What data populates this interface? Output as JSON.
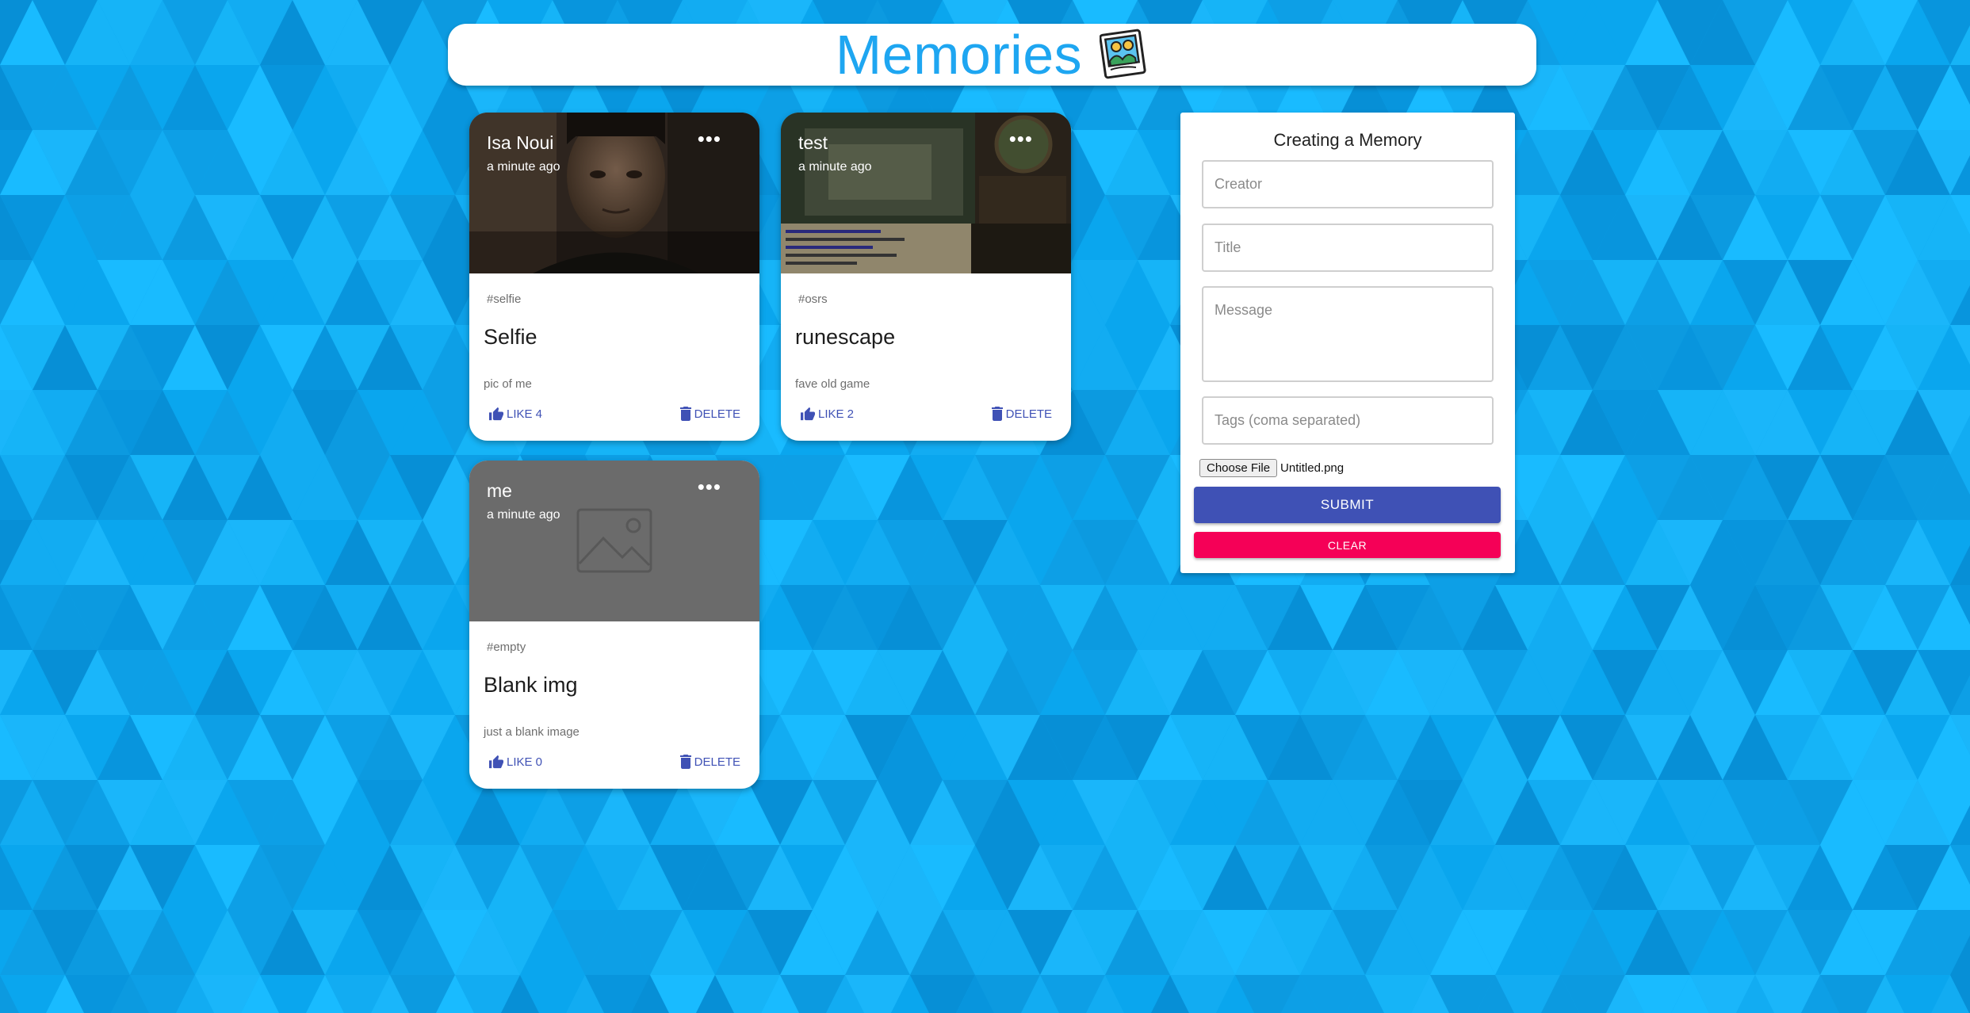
{
  "colors": {
    "primary": "#3f51b5",
    "secondary": "#f50057",
    "title_blue": "#1ea6f1",
    "background": "#0aa6ee"
  },
  "header": {
    "title": "Memories",
    "logo_icon": "memories-photo-icon"
  },
  "posts": [
    {
      "creator": "Isa Noui",
      "time": "a minute ago",
      "tags": "#selfie",
      "title": "Selfie",
      "message": "pic of me",
      "like_label": "LIKE 4",
      "delete_label": "DELETE",
      "more_label": "•••",
      "image": "selfie-photo"
    },
    {
      "creator": "test",
      "time": "a minute ago",
      "tags": "#osrs",
      "title": "runescape",
      "message": "fave old game",
      "like_label": "LIKE 2",
      "delete_label": "DELETE",
      "more_label": "•••",
      "image": "runescape-screenshot"
    },
    {
      "creator": "me",
      "time": "a minute ago",
      "tags": "#empty",
      "title": "Blank img",
      "message": "just a blank image",
      "like_label": "LIKE 0",
      "delete_label": "DELETE",
      "more_label": "•••",
      "image": "image-placeholder-icon"
    }
  ],
  "form": {
    "heading": "Creating a Memory",
    "creator_placeholder": "Creator",
    "title_placeholder": "Title",
    "message_placeholder": "Message",
    "tags_placeholder": "Tags (coma separated)",
    "file_button": "Choose File",
    "file_name": "Untitled.png",
    "submit_label": "SUBMIT",
    "clear_label": "CLEAR"
  }
}
